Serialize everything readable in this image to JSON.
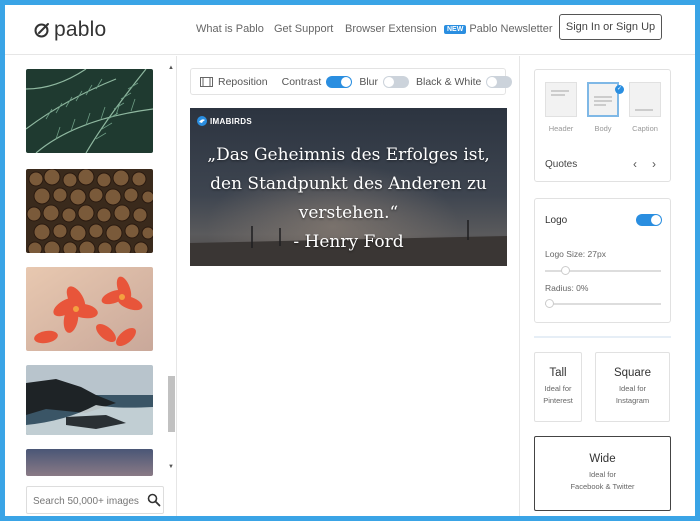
{
  "app": {
    "name": "pablo"
  },
  "nav": {
    "links": [
      "What is Pablo",
      "Get Support",
      "Browser Extension"
    ],
    "newsletter": {
      "badge": "NEW",
      "label": "Pablo Newsletter"
    },
    "signin_label": "Sign In or Sign Up"
  },
  "sidebar": {
    "images": [
      "fern-leaves",
      "stacked-firewood",
      "red-flowers",
      "rocky-coast",
      "dusk-sky"
    ],
    "search": {
      "placeholder": "Search 50,000+ images",
      "value": ""
    }
  },
  "toolbar": {
    "reposition_label": "Reposition",
    "contrast_label": "Contrast",
    "contrast_on": true,
    "blur_label": "Blur",
    "blur_on": false,
    "bw_label": "Black & White",
    "bw_on": false
  },
  "canvas": {
    "brand": "IMABIRDS",
    "quote": "„Das Geheimnis des Erfolges ist, den Standpunkt des Anderen zu verstehen.“",
    "author": "- Henry Ford"
  },
  "right_panel": {
    "text_layouts": [
      {
        "label": "Header",
        "selected": false
      },
      {
        "label": "Body",
        "selected": true
      },
      {
        "label": "Caption",
        "selected": false
      }
    ],
    "font_label": "Quotes",
    "logo": {
      "label": "Logo",
      "enabled": true,
      "size_label": "Logo Size: 27px",
      "size_level": 0.17,
      "radius_label": "Radius: 0%",
      "radius_level": 0.0
    },
    "sizes": {
      "tall": {
        "title": "Tall",
        "line1": "Ideal for",
        "line2": "Pinterest"
      },
      "square": {
        "title": "Square",
        "line1": "Ideal for",
        "line2": "Instagram"
      },
      "wide": {
        "title": "Wide",
        "line1": "Ideal for",
        "line2": "Facebook & Twitter",
        "selected": true
      }
    }
  },
  "colors": {
    "accent": "#2a8ee0",
    "frame": "#3aa4e6"
  }
}
